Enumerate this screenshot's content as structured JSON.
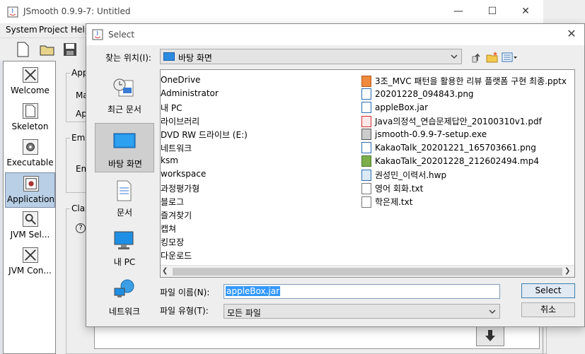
{
  "main": {
    "title": "JSmooth 0.9.9-7: Untitled",
    "menu": [
      "System",
      "Project",
      "Help"
    ],
    "nav": [
      "Welcome",
      "Skeleton",
      "Executable",
      "Application",
      "JVM Sel...",
      "JVM Con..."
    ],
    "groups": {
      "g1_title": "App",
      "g1_l1": "Ma",
      "g1_l2": "Ap",
      "g2_title": "Emb",
      "g2_l1": "Em",
      "g3_title": "Clas"
    }
  },
  "dialog": {
    "title": "Select",
    "lookin_label": "찾는 위치(I):",
    "lookin_value": "바탕 화면",
    "places": [
      "최근 문서",
      "바탕 화면",
      "문서",
      "내 PC",
      "네트워크"
    ],
    "files_col1": [
      "OneDrive",
      "Administrator",
      "내 PC",
      "라이브러리",
      "DVD RW 드라이브 (E:)",
      "네트워크",
      "ksm",
      "workspace",
      "과정평가형",
      "블로그",
      "즐겨찾기",
      "캡쳐",
      "킹모장",
      "다운로드"
    ],
    "files_col2": [
      {
        "name": "3조_MVC 패턴을 활용한 리뷰 플랫폼 구현 최종.pptx",
        "icon": "pptx-icon"
      },
      {
        "name": "20201228_094843.png",
        "icon": "image-file-icon"
      },
      {
        "name": "appleBox.jar",
        "icon": "jar-file-icon"
      },
      {
        "name": "Java의정석_연습문제답안_20100310v1.pdf",
        "icon": "pdf-file-icon"
      },
      {
        "name": "jsmooth-0.9.9-7-setup.exe",
        "icon": "exe-file-icon"
      },
      {
        "name": "KakaoTalk_20201221_165703661.png",
        "icon": "image-file-icon"
      },
      {
        "name": "KakaoTalk_20201228_212602494.mp4",
        "icon": "video-file-icon"
      },
      {
        "name": "권성민_이력서.hwp",
        "icon": "hwp-file-icon"
      },
      {
        "name": "영어 회화.txt",
        "icon": "text-file-icon"
      },
      {
        "name": "학은제.txt",
        "icon": "text-file-icon"
      }
    ],
    "filename_label": "파일 이름(N):",
    "filename_value": "appleBox.jar",
    "filetype_label": "파일 유형(T):",
    "filetype_value": "모든 파일",
    "select_label": "Select",
    "cancel_label": "취소"
  }
}
